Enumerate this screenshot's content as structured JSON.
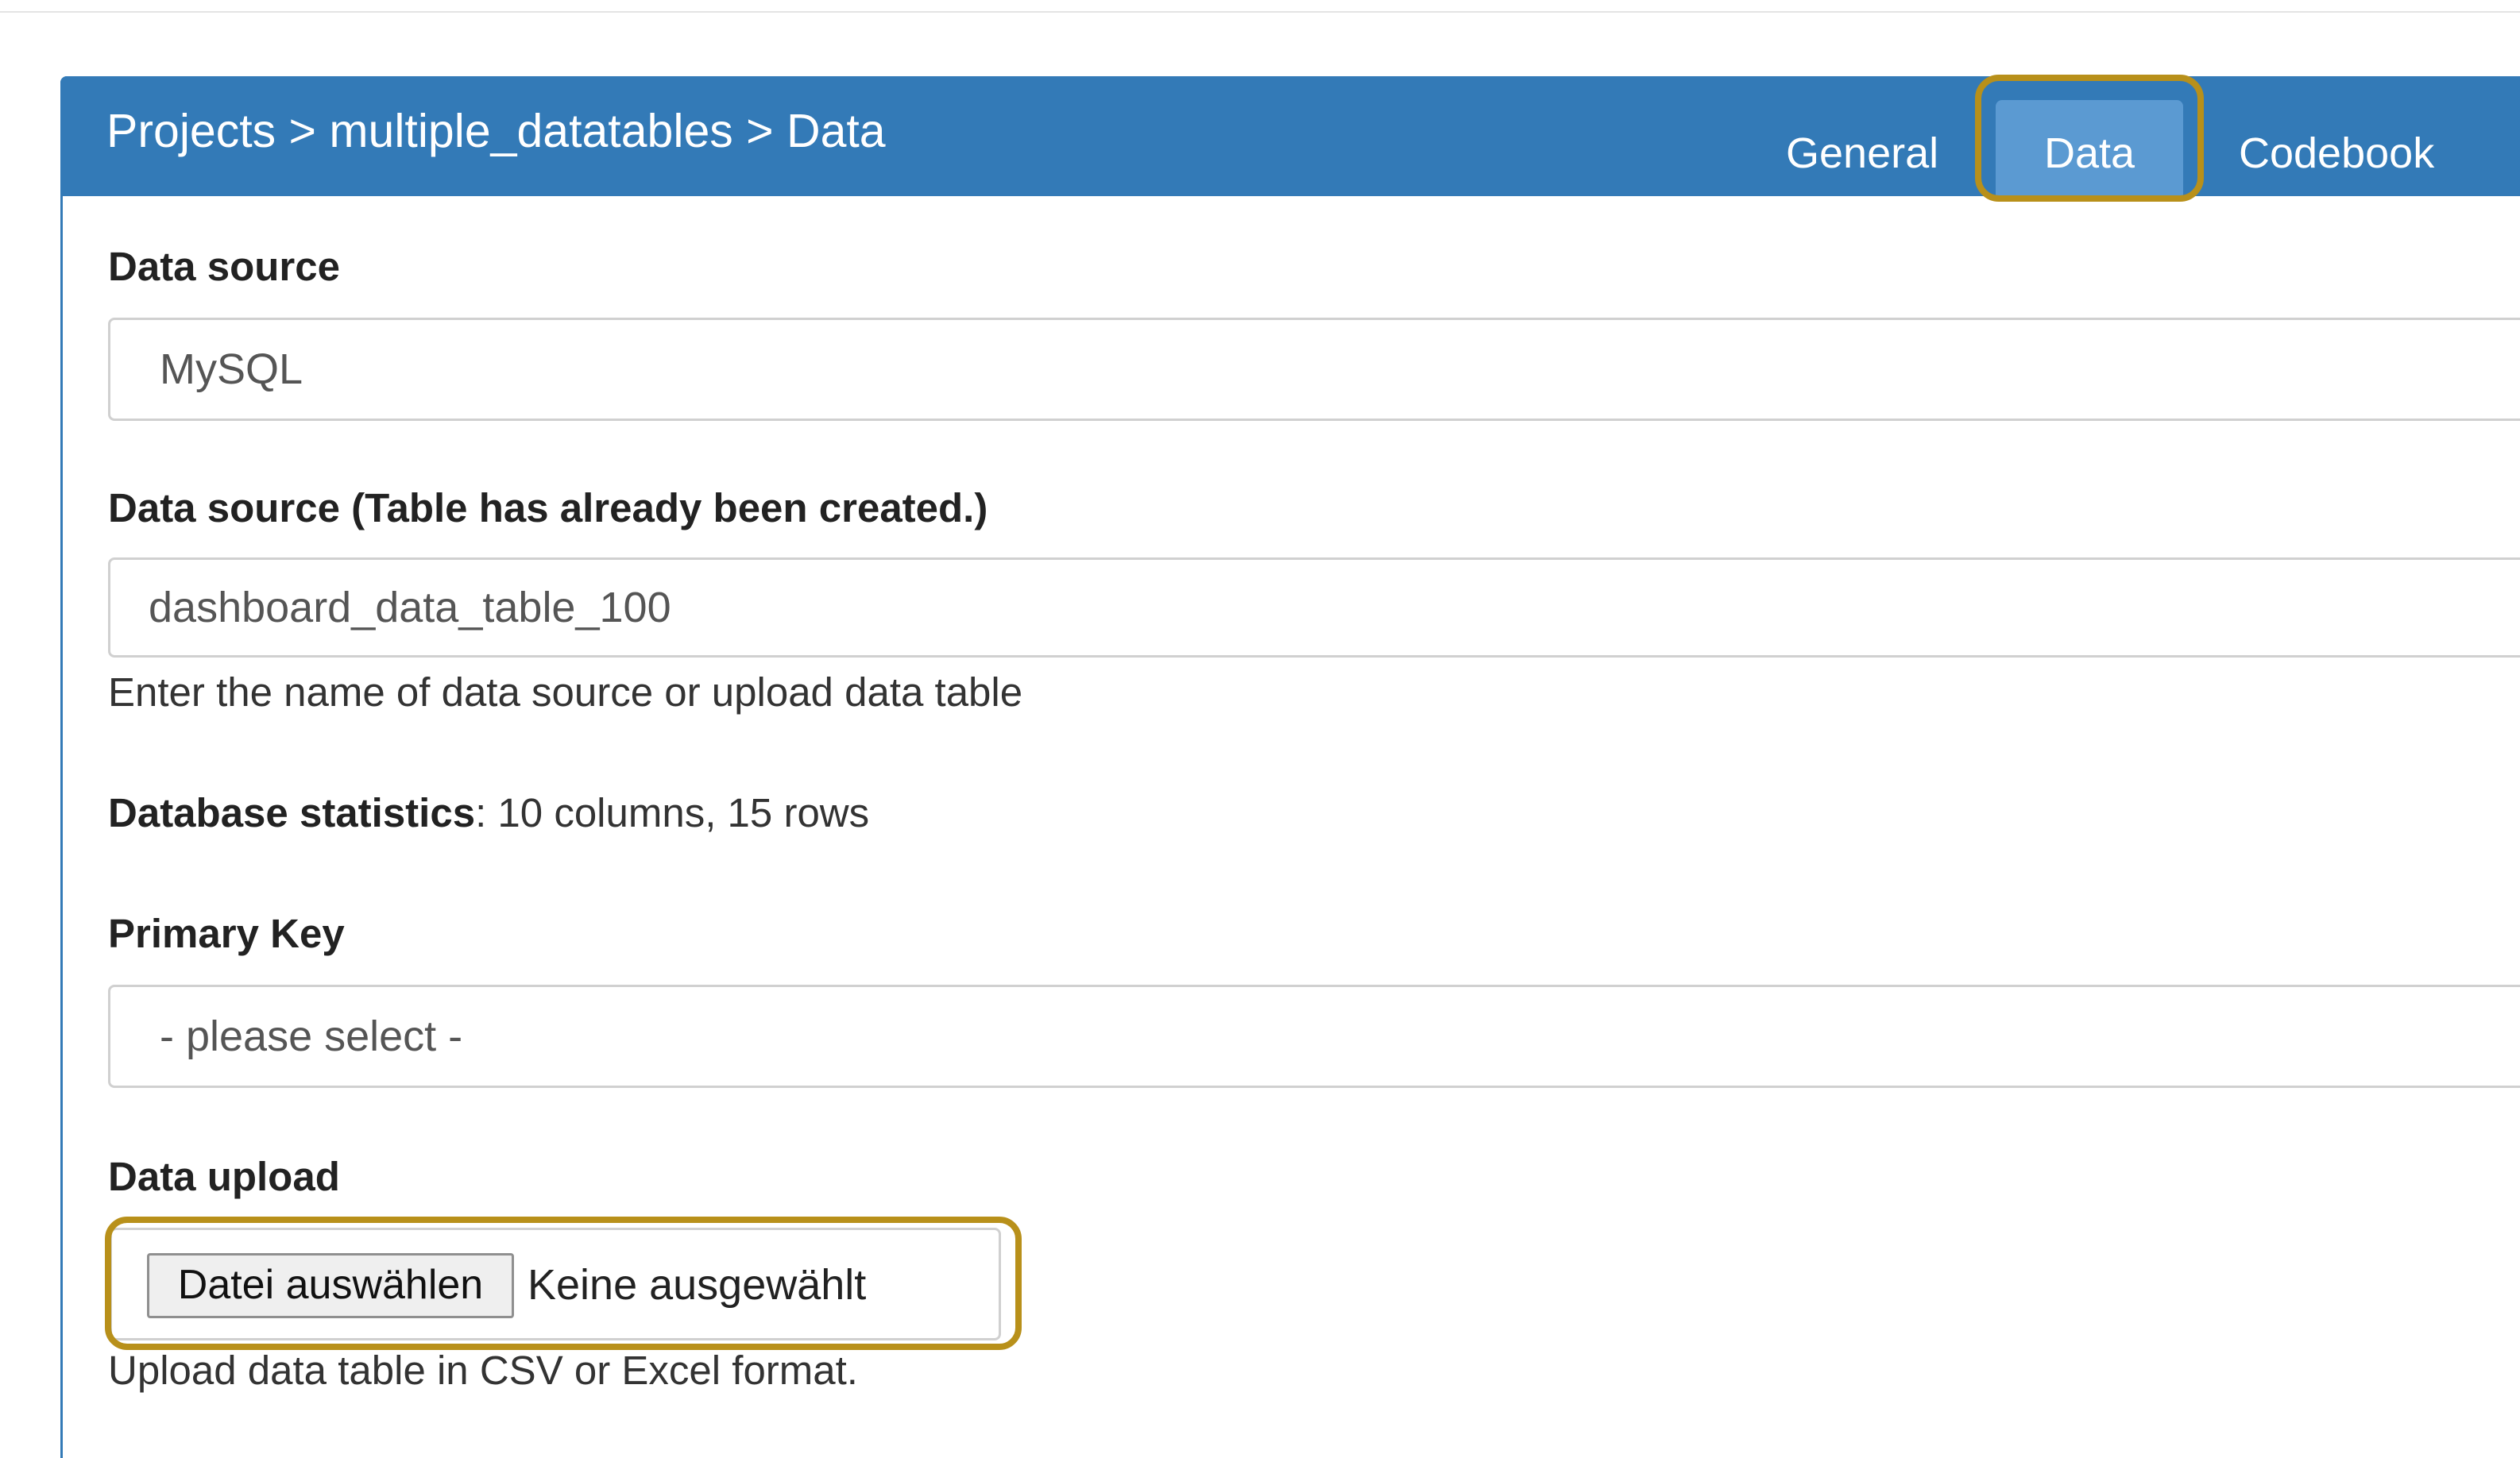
{
  "header": {
    "breadcrumb": "Projects > multiple_datatables > Data",
    "tabs": [
      {
        "label": "General",
        "active": false
      },
      {
        "label": "Data",
        "active": true
      },
      {
        "label": "Codebook",
        "active": false
      }
    ]
  },
  "form": {
    "data_source": {
      "label": "Data source",
      "value": "MySQL"
    },
    "data_table": {
      "label": "Data source (Table has already been created.)",
      "value": "dashboard_data_table_100",
      "help": "Enter the name of data source or upload data table"
    },
    "statistics": {
      "label": "Database statistics",
      "value": ": 10 columns, 15 rows"
    },
    "primary_key": {
      "label": "Primary Key",
      "value": "- please select -"
    },
    "upload": {
      "label": "Data upload",
      "button_label": "Datei auswählen",
      "status": "Keine ausgewählt",
      "help": "Upload data table in CSV or Excel format."
    }
  },
  "colors": {
    "header": "#337ab7",
    "active_tab": "#5b9ad2",
    "highlight": "#b8901a"
  }
}
